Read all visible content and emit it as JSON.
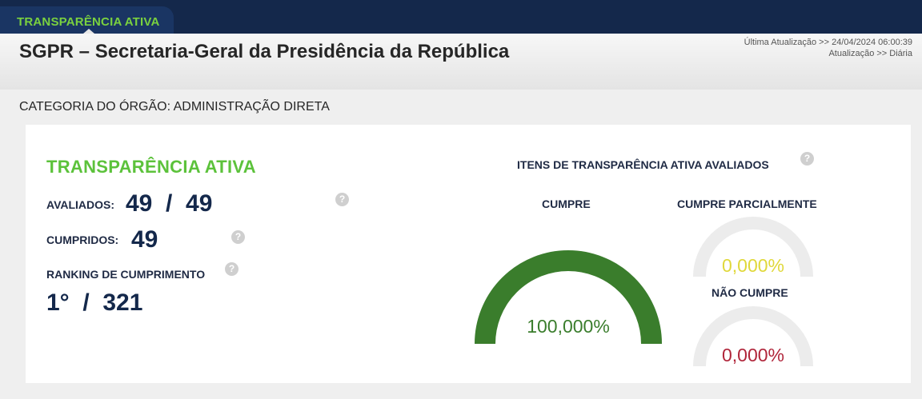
{
  "header": {
    "tab_label": "TRANSPARÊNCIA ATIVA",
    "title": "SGPR – Secretaria-Geral da Presidência da República",
    "last_update": "Última Atualização >> 24/04/2024 06:00:39",
    "update_freq": "Atualização >> Diária"
  },
  "category": "CATEGORIA DO ÓRGÃO: ADMINISTRAÇÃO DIRETA",
  "summary": {
    "section_title": "TRANSPARÊNCIA ATIVA",
    "evaluated_label": "AVALIADOS:",
    "evaluated_value": "49  /  49",
    "fulfilled_label": "CUMPRIDOS:",
    "fulfilled_value": "49",
    "ranking_label": "RANKING DE CUMPRIMENTO",
    "ranking_value": "1°  /  321"
  },
  "items": {
    "title": "ITENS DE TRANSPARÊNCIA ATIVA AVALIADOS",
    "help": "?",
    "gauges": [
      {
        "label": "CUMPRE",
        "value_text": "100,000%",
        "fraction": 1.0,
        "color": "#3a7d2c",
        "text_color": "#3a7d2c"
      },
      {
        "label": "CUMPRE PARCIALMENTE",
        "value_text": "0,000%",
        "fraction": 0.0,
        "color": "#e8e23a",
        "text_color": "#e0d83a"
      },
      {
        "label": "NÃO CUMPRE",
        "value_text": "0,000%",
        "fraction": 0.0,
        "color": "#b0253a",
        "text_color": "#b0253a"
      }
    ]
  },
  "colors": {
    "navy": "#14284b",
    "accent_green": "#5cc23b",
    "track": "#ececec"
  }
}
